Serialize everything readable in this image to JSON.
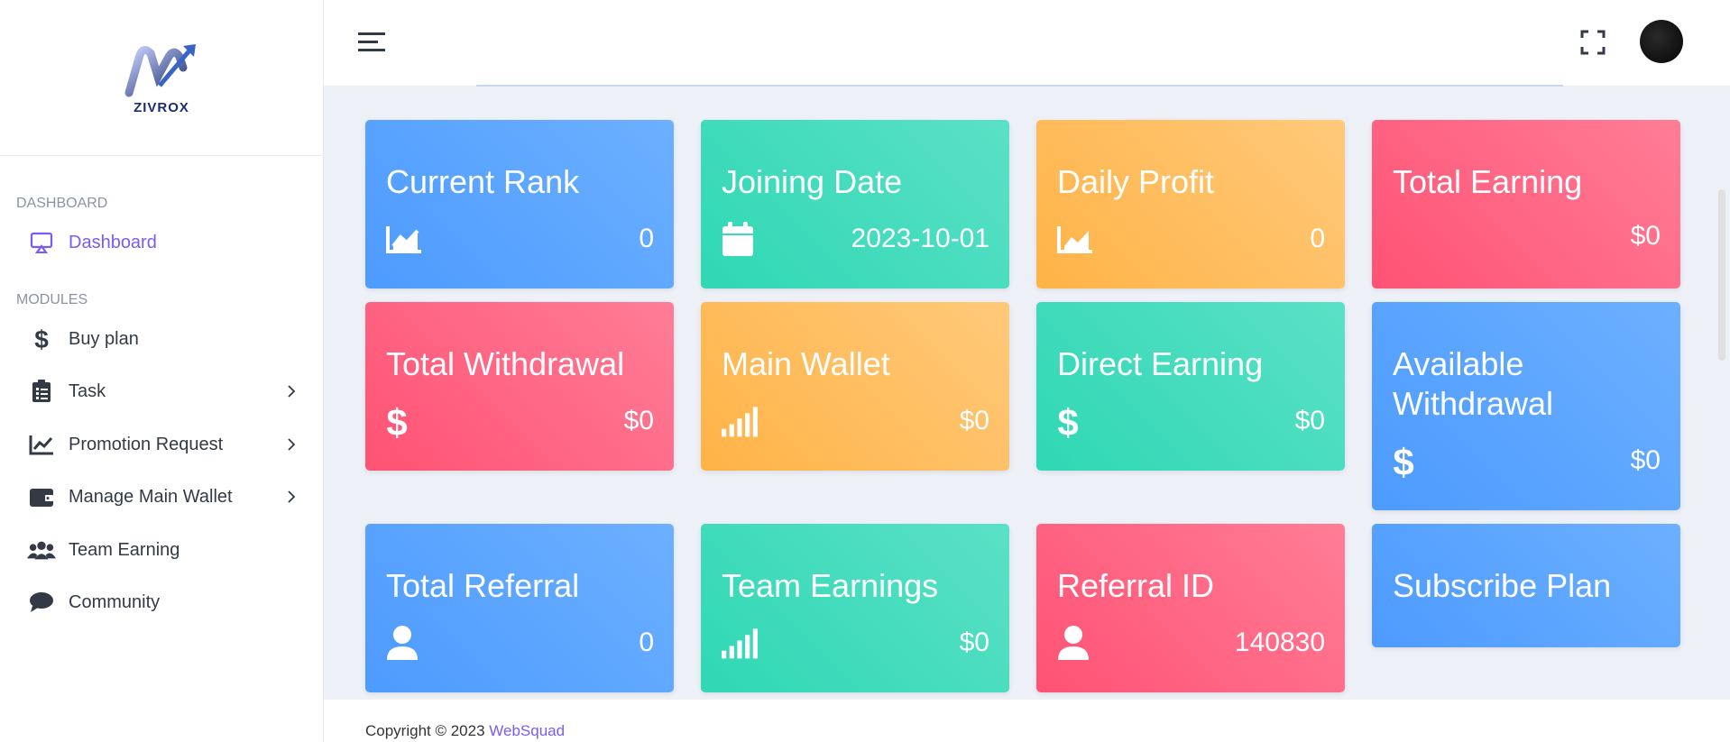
{
  "brand": {
    "logo_text": "ZIVROX"
  },
  "sidebar": {
    "sections": [
      {
        "label": "DASHBOARD"
      },
      {
        "label": "MODULES"
      }
    ],
    "items": [
      {
        "label": "Dashboard",
        "icon": "monitor-icon"
      },
      {
        "label": "Buy plan",
        "icon": "dollar-icon"
      },
      {
        "label": "Task",
        "icon": "clipboard-icon"
      },
      {
        "label": "Promotion Request",
        "icon": "chart-line-icon"
      },
      {
        "label": "Manage Main Wallet",
        "icon": "wallet-icon"
      },
      {
        "label": "Team Earning",
        "icon": "users-icon"
      },
      {
        "label": "Community",
        "icon": "comment-icon"
      }
    ]
  },
  "cards": [
    {
      "title": "Current Rank",
      "value": "0",
      "icon": "chart-line-icon",
      "color": "#4d9bff"
    },
    {
      "title": "Joining Date",
      "value": "2023-10-01",
      "icon": "calendar-icon",
      "color": "#2fd8b4"
    },
    {
      "title": "Daily Profit",
      "value": "0",
      "icon": "chart-line-icon",
      "color": "#ffb347"
    },
    {
      "title": "Total Earning",
      "value": "$0",
      "icon": "",
      "color": "#ff5274"
    },
    {
      "title": "Total Withdrawal",
      "value": "$0",
      "icon": "dollar-icon",
      "color": "#ff5274"
    },
    {
      "title": "Main Wallet",
      "value": "$0",
      "icon": "signal-bars-icon",
      "color": "#ffb347"
    },
    {
      "title": "Direct Earning",
      "value": "$0",
      "icon": "dollar-icon",
      "color": "#2fd8b4"
    },
    {
      "title": "Available Withdrawal",
      "value": "$0",
      "icon": "dollar-icon",
      "color": "#4d9bff"
    },
    {
      "title": "Total Referral",
      "value": "0",
      "icon": "user-icon",
      "color": "#4d9bff"
    },
    {
      "title": "Team Earnings",
      "value": "$0",
      "icon": "signal-bars-icon",
      "color": "#2fd8b4"
    },
    {
      "title": "Referral ID",
      "value": "140830",
      "icon": "user-icon",
      "color": "#ff5274"
    },
    {
      "title": "Subscribe Plan",
      "value": "",
      "icon": "",
      "color": "#4d9bff"
    }
  ],
  "footer": {
    "copyright": "Copyright © 2023 ",
    "brand": "WebSquad"
  }
}
